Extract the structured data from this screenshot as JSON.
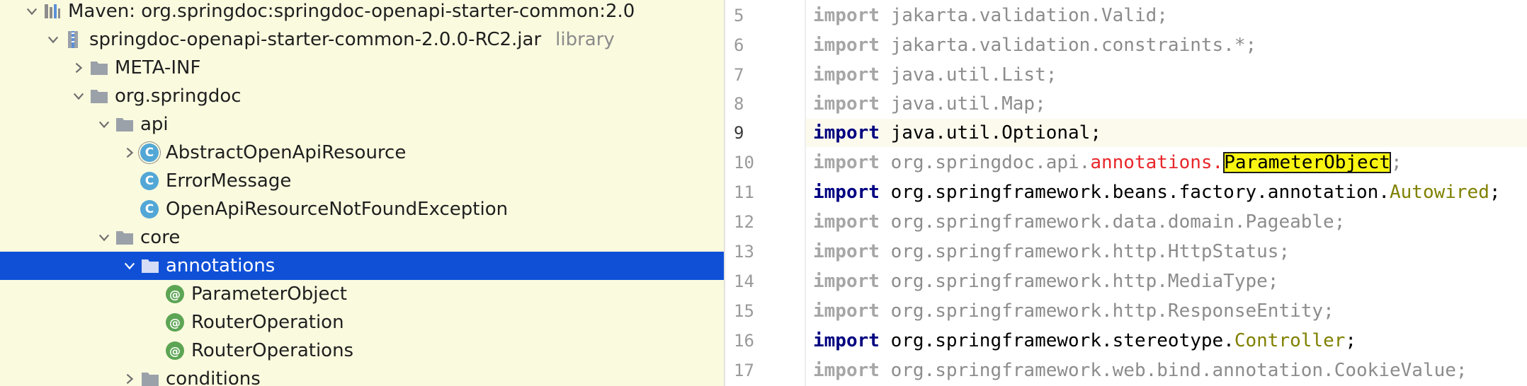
{
  "tree": {
    "rows": [
      {
        "label": "Maven: org.springdoc:springdoc-openapi-starter-common:2.0",
        "icon": "library-icon",
        "arrow": "expanded",
        "level": 0
      },
      {
        "label": "springdoc-openapi-starter-common-2.0.0-RC2.jar",
        "suffix": "library",
        "icon": "jar-icon",
        "arrow": "expanded",
        "level": 1
      },
      {
        "label": "META-INF",
        "icon": "folder-icon",
        "arrow": "collapsed",
        "level": 2
      },
      {
        "label": "org.springdoc",
        "icon": "folder-icon",
        "arrow": "expanded",
        "level": 2
      },
      {
        "label": "api",
        "icon": "folder-icon",
        "arrow": "expanded",
        "level": 3
      },
      {
        "label": "AbstractOpenApiResource",
        "icon": "abstract-class-icon",
        "arrow": "collapsed",
        "level": 4
      },
      {
        "label": "ErrorMessage",
        "icon": "class-icon",
        "arrow": "none",
        "level": 4
      },
      {
        "label": "OpenApiResourceNotFoundException",
        "icon": "class-icon",
        "arrow": "none",
        "level": 4
      },
      {
        "label": "core",
        "icon": "folder-icon",
        "arrow": "expanded",
        "level": 3
      },
      {
        "label": "annotations",
        "icon": "folder-icon",
        "arrow": "expanded",
        "level": 4,
        "selected": true
      },
      {
        "label": "ParameterObject",
        "icon": "annotation-icon",
        "arrow": "none",
        "level": 5
      },
      {
        "label": "RouterOperation",
        "icon": "annotation-icon",
        "arrow": "none",
        "level": 5
      },
      {
        "label": "RouterOperations",
        "icon": "annotation-icon",
        "arrow": "none",
        "level": 5
      },
      {
        "label": "conditions",
        "icon": "folder-icon",
        "arrow": "collapsed",
        "level": 4
      }
    ],
    "badges": {
      "class": "C",
      "annotation": "@"
    }
  },
  "editor": {
    "current_line": "9",
    "lines": [
      {
        "num": "5",
        "kw": "import",
        "pkg": "jakarta.validation.Valid",
        "semi": ";"
      },
      {
        "num": "6",
        "kw": "import",
        "pkg": "jakarta.validation.constraints.*",
        "semi": ";"
      },
      {
        "num": "7",
        "kw": "import",
        "pkg": "java.util.List",
        "semi": ";"
      },
      {
        "num": "8",
        "kw": "import",
        "pkg": "java.util.Map",
        "semi": ";"
      },
      {
        "num": "9",
        "kw": "import",
        "pkg": "java.util.Optional",
        "semi": ";"
      },
      {
        "num": "10",
        "kw": "import",
        "pkg": "org.springdoc.api.",
        "err": "annotations.",
        "hl": "ParameterObject",
        "semi": ";"
      },
      {
        "num": "11",
        "kw": "import",
        "pkg": "org.springframework.beans.factory.annotation.",
        "cls": "Autowired",
        "semi": ";"
      },
      {
        "num": "12",
        "kw": "import",
        "pkg": "org.springframework.data.domain.Pageable",
        "semi": ";"
      },
      {
        "num": "13",
        "kw": "import",
        "pkg": "org.springframework.http.HttpStatus",
        "semi": ";"
      },
      {
        "num": "14",
        "kw": "import",
        "pkg": "org.springframework.http.MediaType",
        "semi": ";"
      },
      {
        "num": "15",
        "kw": "import",
        "pkg": "org.springframework.http.ResponseEntity",
        "semi": ";"
      },
      {
        "num": "16",
        "kw": "import",
        "pkg": "org.springframework.stereotype.",
        "cls": "Controller",
        "semi": ";"
      },
      {
        "num": "17",
        "kw": "import",
        "pkg": "org.springframework.web.bind.annotation.CookieValue",
        "semi": ";"
      }
    ],
    "used_lines": [
      "9",
      "11",
      "16"
    ]
  },
  "colors": {
    "tree_bg": "#fafadf",
    "selection": "#0f50d7",
    "keyword": "#000080",
    "error": "#e8262a",
    "highlight": "#f9f513",
    "annotation_class": "#808000"
  }
}
